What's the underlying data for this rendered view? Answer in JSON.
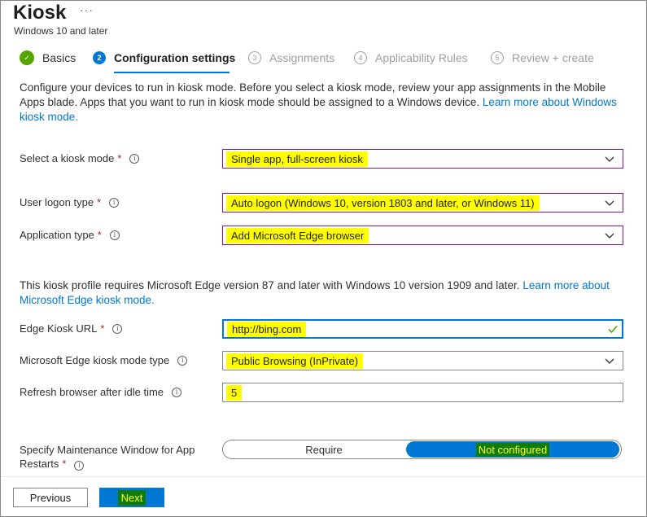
{
  "header": {
    "title": "Kiosk",
    "more": "···",
    "subtitle": "Windows 10 and later"
  },
  "steps": [
    {
      "num": "✓",
      "label": "Basics",
      "state": "done"
    },
    {
      "num": "2",
      "label": "Configuration settings",
      "state": "active"
    },
    {
      "num": "3",
      "label": "Assignments",
      "state": "inactive"
    },
    {
      "num": "4",
      "label": "Applicability Rules",
      "state": "inactive"
    },
    {
      "num": "5",
      "label": "Review + create",
      "state": "inactive"
    }
  ],
  "intro": {
    "text": "Configure your devices to run in kiosk mode. Before you select a kiosk mode, review your app assignments in the Mobile Apps blade. Apps that you want to run in kiosk mode should be assigned to a Windows device. ",
    "link": "Learn more about Windows kiosk mode."
  },
  "fields": {
    "kiosk_mode": {
      "label": "Select a kiosk mode",
      "value": "Single app, full-screen kiosk"
    },
    "logon_type": {
      "label": "User logon type",
      "value": "Auto logon (Windows 10, version 1803 and later, or Windows 11)"
    },
    "app_type": {
      "label": "Application type",
      "value": "Add Microsoft Edge browser"
    },
    "edge_url": {
      "label": "Edge Kiosk URL",
      "value": "http://bing.com"
    },
    "edge_mode": {
      "label": "Microsoft Edge kiosk mode type",
      "value": "Public Browsing (InPrivate)"
    },
    "refresh": {
      "label": "Refresh browser after idle time",
      "value": "5"
    }
  },
  "required_mark": "*",
  "info_glyph": "i",
  "note": {
    "text": "This kiosk profile requires Microsoft Edge version 87 and later with Windows 10 version 1909 and later. ",
    "link": "Learn more about Microsoft Edge kiosk mode."
  },
  "maintenance": {
    "label": "Specify Maintenance Window for App Restarts",
    "option_left": "Require",
    "option_right": "Not configured",
    "selected": "Not configured"
  },
  "footer": {
    "previous": "Previous",
    "next": "Next"
  },
  "colors": {
    "accent": "#0078d4",
    "success": "#57a300",
    "highlight": "#ffff00"
  }
}
